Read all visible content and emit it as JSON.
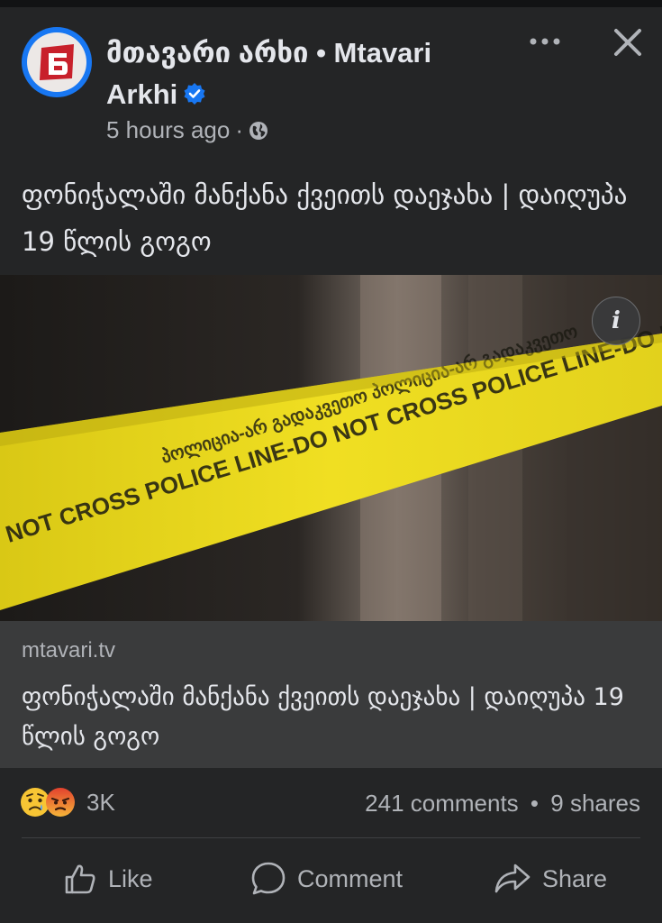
{
  "post": {
    "author_line1": "მთავარი არხი • Mtavari",
    "author_line2": "Arkhi",
    "timestamp": "5 hours ago",
    "meta_separator": "·",
    "caption": "ფონიჭალაში მანქანა ქვეითს დაეჯახა | დაიღუპა 19 წლის გოგო"
  },
  "image": {
    "tape_text": "NOT CROSS POLICE LINE-DO NOT CROSS POLICE LINE-DO NOT CROSS",
    "tape_text_georgian": "პოლიცია-არ გადაკვეთო პოლიცია-არ გადაკვეთო",
    "info_label": "i"
  },
  "link_preview": {
    "domain": "mtavari.tv",
    "title": "ფონიჭალაში მანქანა ქვეითს დაეჯახა | დაიღუპა 19 წლის გოგო"
  },
  "engagement": {
    "reaction_count": "3K",
    "comments": "241 comments",
    "separator": "•",
    "shares": "9 shares"
  },
  "actions": {
    "like": "Like",
    "comment": "Comment",
    "share": "Share"
  },
  "colors": {
    "background": "#242526",
    "accent": "#1877f2",
    "tape": "#e6d51c",
    "brand_red": "#c8202b"
  },
  "icons": {
    "avatar": "mtavari-logo",
    "verified": "verified-badge-icon",
    "privacy": "globe-icon",
    "more": "more-options-icon",
    "close": "close-icon",
    "info": "info-icon",
    "reaction1": "sad-reaction-icon",
    "reaction2": "angry-reaction-icon",
    "like": "thumbs-up-icon",
    "comment": "comment-bubble-icon",
    "share": "share-arrow-icon"
  }
}
